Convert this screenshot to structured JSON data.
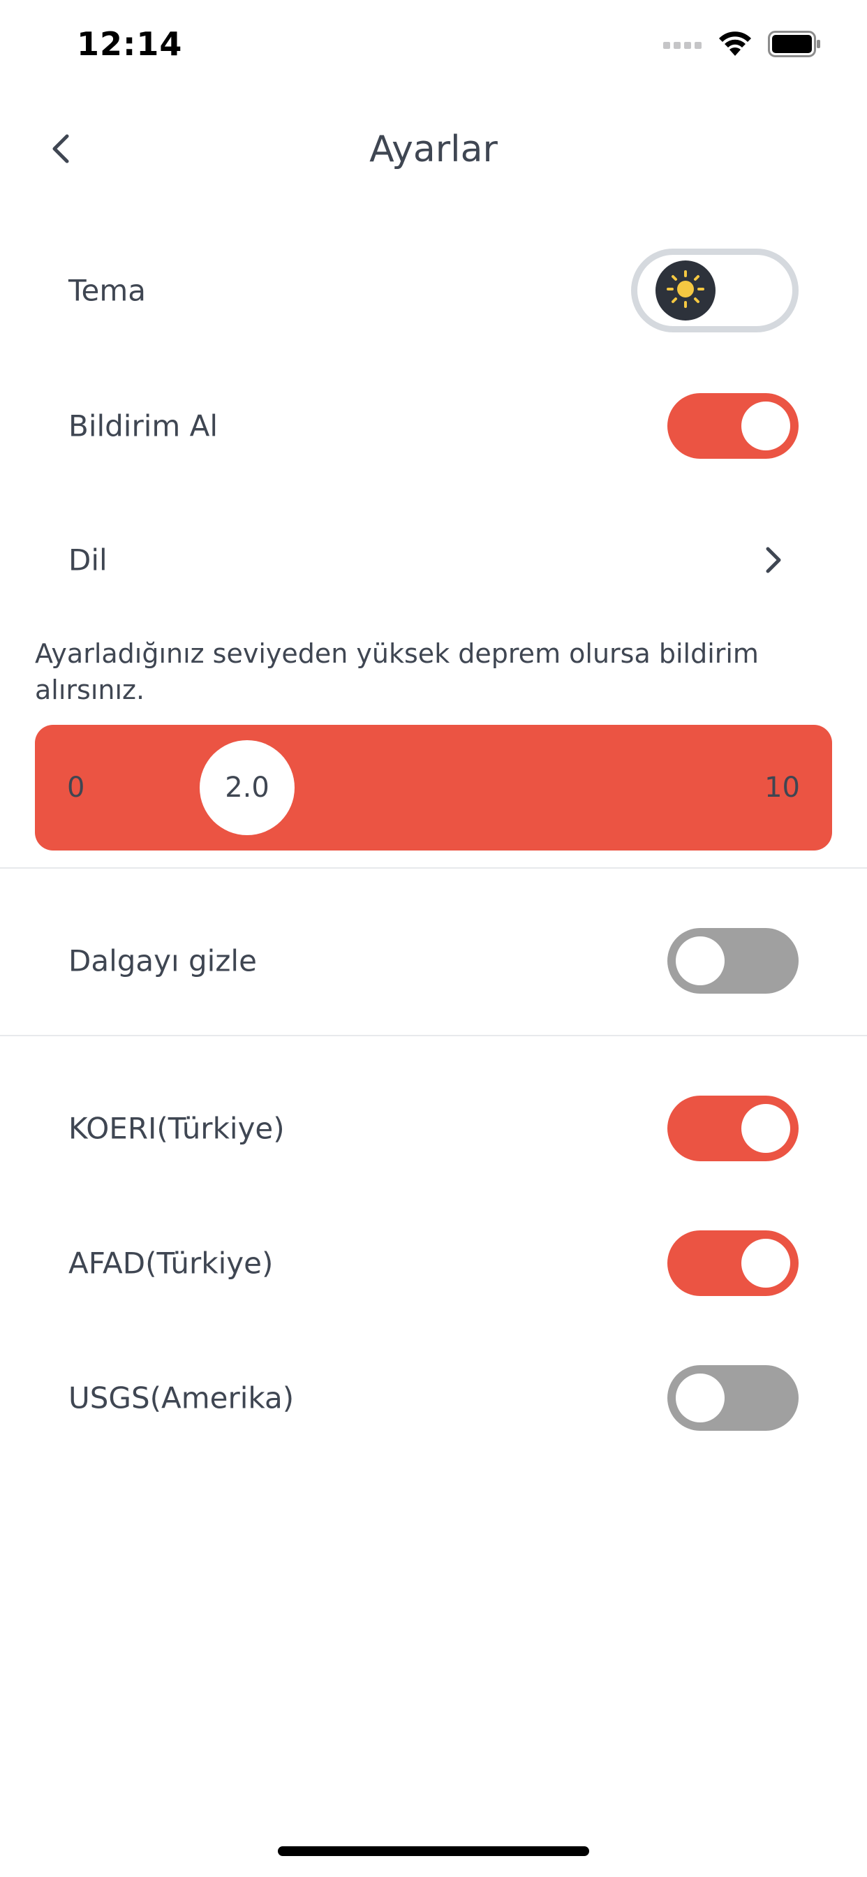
{
  "status_bar": {
    "time": "12:14",
    "icons": [
      "signal-icon",
      "wifi-icon",
      "battery-icon"
    ]
  },
  "header": {
    "back_icon": "chevron-left-icon",
    "title": "Ayarlar"
  },
  "settings": {
    "theme": {
      "label": "Tema",
      "mode": "light",
      "icon": "sun-icon"
    },
    "notifications": {
      "label": "Bildirim Al",
      "on": true
    },
    "language": {
      "label": "Dil",
      "icon": "chevron-right-icon"
    }
  },
  "magnitude": {
    "info": "Ayarladığınız seviyeden yüksek deprem olursa bildirim alırsınız.",
    "min_label": "0",
    "max_label": "10",
    "min": 0,
    "max": 10,
    "value": 2.0,
    "value_label": "2.0"
  },
  "wave": {
    "label": "Dalgayı gizle",
    "on": false
  },
  "sources": [
    {
      "label": "KOERI(Türkiye)",
      "on": true
    },
    {
      "label": "AFAD(Türkiye)",
      "on": true
    },
    {
      "label": "USGS(Amerika)",
      "on": false
    }
  ],
  "colors": {
    "accent": "#eb5443",
    "switch_off": "#a0a0a0",
    "text": "#3f4652",
    "sun": "#f5c842",
    "theme_knob": "#2d323b"
  }
}
